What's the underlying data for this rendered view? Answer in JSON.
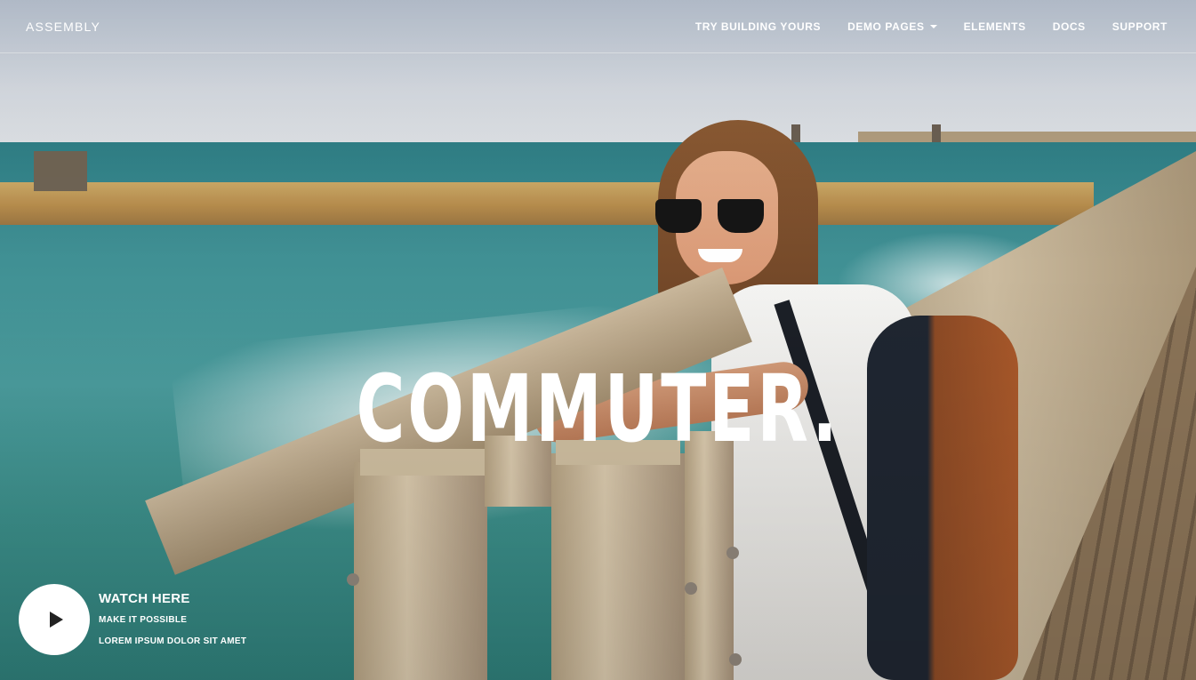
{
  "brand": {
    "name": "ASSEMBLY"
  },
  "nav": {
    "items": [
      {
        "label": "TRY BUILDING YOURS"
      },
      {
        "label": "DEMO PAGES"
      },
      {
        "label": "ELEMENTS"
      },
      {
        "label": "DOCS"
      },
      {
        "label": "SUPPORT"
      }
    ]
  },
  "hero": {
    "headline": "COMMUTER.",
    "background_icon": "commuter-photo"
  },
  "video": {
    "icon": "play-icon",
    "title": "WATCH HERE",
    "subtitle": "MAKE IT POSSIBLE",
    "caption": "LOREM IPSUM DOLOR SIT AMET"
  }
}
